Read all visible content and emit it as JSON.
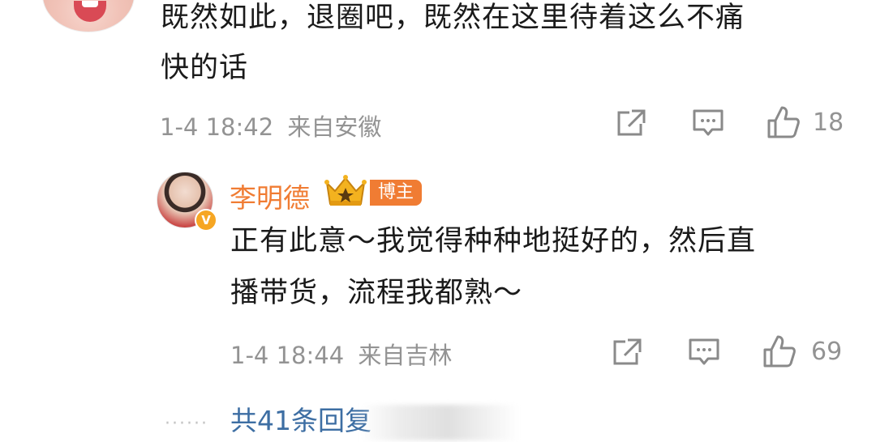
{
  "top_comment": {
    "line1": "既然如此，退圈吧，既然在这里待着这么不痛",
    "line2": "快的话",
    "time": "1-4 18:42",
    "location": "来自安徽",
    "likes": "18",
    "icons": [
      "share-icon",
      "comment-icon",
      "like-icon"
    ]
  },
  "reply": {
    "username": "李明德",
    "tag": "博主",
    "verified_badge": "V",
    "line1": "正有此意～我觉得种种地挺好的，然后直",
    "line2": "播带货，流程我都熟～",
    "time": "1-4 18:44",
    "location": "来自吉林",
    "likes": "69",
    "icons": [
      "share-icon",
      "comment-icon",
      "like-icon"
    ]
  },
  "footer": {
    "dots": "······",
    "more_replies": "共41条回复"
  },
  "colors": {
    "username": "#f07c33",
    "tag_bg": "#f07c33",
    "link": "#3d6ea3",
    "meta": "#939393",
    "badge": "#f6a623"
  }
}
